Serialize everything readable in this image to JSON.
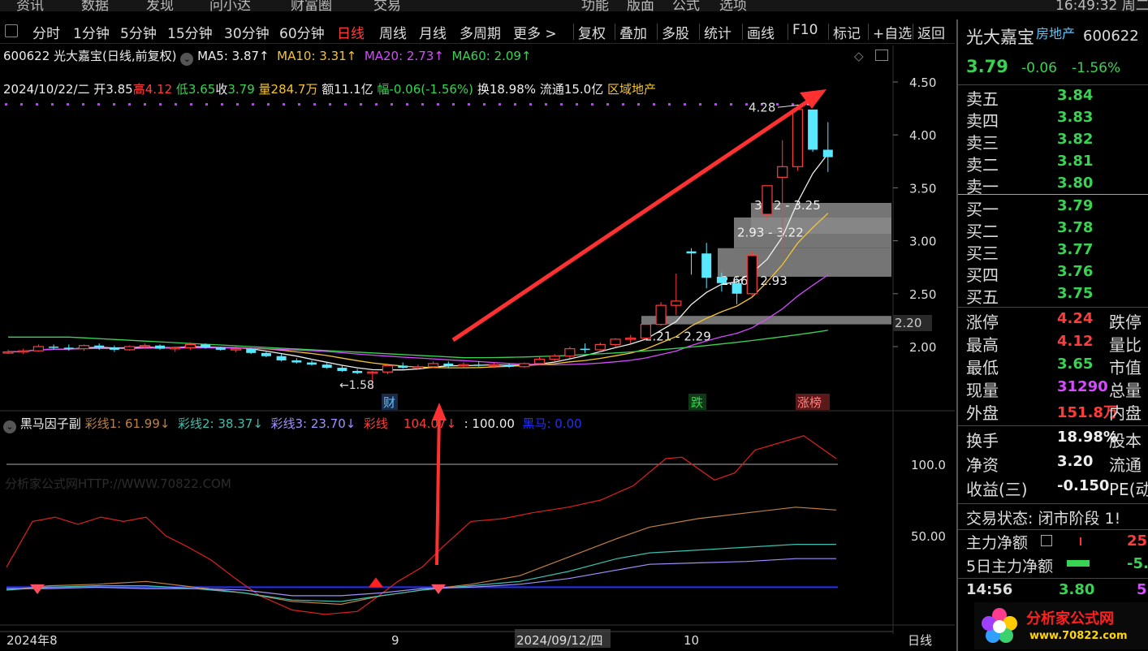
{
  "topbar": {
    "items": [
      "资讯",
      "数据",
      "发现",
      "问小达",
      "财富圈",
      "交易",
      "功能",
      "版面",
      "公式",
      "选项"
    ],
    "clock": "16:49:32 周二"
  },
  "toolbar": {
    "periods": [
      "分时",
      "1分钟",
      "5分钟",
      "15分钟",
      "30分钟",
      "60分钟",
      "日线",
      "周线",
      "月线",
      "多周期",
      "更多 >"
    ],
    "active": "日线",
    "tools": [
      "复权",
      "叠加",
      "多股",
      "统计",
      "画线",
      "F10",
      "标记",
      "+自选",
      "返回"
    ]
  },
  "header": {
    "title": "600622 光大嘉宝(日线,前复权)",
    "ma5": "MA5: 3.87↑",
    "ma10": "MA10: 3.31↑",
    "ma20": "MA20: 2.73↑",
    "ma60": "MA60: 2.09↑"
  },
  "quote_line": {
    "date": "2024/10/22/二",
    "open": "开3.85",
    "high_lbl": "高",
    "high": "4.12",
    "low_lbl": "低",
    "low": "3.65",
    "close_lbl": "收",
    "close": "3.79",
    "vol": "量284.7万",
    "amt": "额11.1亿",
    "chg": "幅-0.06(-1.56%)",
    "turnover": "换18.98%",
    "float": "流通15.0亿",
    "sector": "区域地产"
  },
  "chart_data": {
    "type": "candlestick",
    "y_ticks": [
      "4.50",
      "4.00",
      "3.50",
      "3.00",
      "2.50",
      "2.00"
    ],
    "y_range": [
      1.6,
      4.55
    ],
    "x_labels": [
      "2024年8",
      "9",
      "2024/09/12/四",
      "10",
      "日线"
    ],
    "price_marker": "2.20",
    "annotations": {
      "high": "4.28",
      "low": "1.58",
      "fin": "财",
      "drop": "跌",
      "limit": "涨榜"
    },
    "gaps": [
      {
        "label": "3.22 - 3.25",
        "from": 3.22,
        "to": 3.25
      },
      {
        "label": "2.93 - 3.22",
        "from": 2.93,
        "to": 3.22
      },
      {
        "label": "2.66 - 2.93",
        "from": 2.66,
        "to": 2.93
      },
      {
        "label": "2.21 - 2.29",
        "from": 2.21,
        "to": 2.29
      }
    ],
    "candles": [
      [
        1.95,
        1.97,
        1.93,
        1.95
      ],
      [
        1.95,
        1.98,
        1.93,
        1.96
      ],
      [
        1.96,
        2.02,
        1.95,
        2.0
      ],
      [
        2.0,
        2.02,
        1.97,
        1.99
      ],
      [
        1.99,
        2.02,
        1.96,
        1.98
      ],
      [
        1.98,
        2.02,
        1.96,
        2.01
      ],
      [
        2.01,
        2.03,
        1.97,
        1.99
      ],
      [
        1.99,
        2.01,
        1.95,
        1.97
      ],
      [
        1.97,
        2.01,
        1.96,
        2.0
      ],
      [
        2.0,
        2.03,
        1.98,
        2.01
      ],
      [
        2.01,
        2.02,
        1.97,
        1.98
      ],
      [
        1.98,
        2.0,
        1.95,
        1.99
      ],
      [
        1.99,
        2.04,
        1.97,
        2.02
      ],
      [
        2.02,
        2.03,
        1.98,
        1.99
      ],
      [
        1.99,
        2.0,
        1.96,
        1.97
      ],
      [
        1.97,
        2.0,
        1.95,
        1.98
      ],
      [
        1.98,
        1.99,
        1.93,
        1.94
      ],
      [
        1.94,
        1.95,
        1.9,
        1.91
      ],
      [
        1.91,
        1.93,
        1.86,
        1.87
      ],
      [
        1.87,
        1.89,
        1.84,
        1.85
      ],
      [
        1.85,
        1.87,
        1.82,
        1.83
      ],
      [
        1.83,
        1.85,
        1.79,
        1.8
      ],
      [
        1.8,
        1.82,
        1.76,
        1.77
      ],
      [
        1.77,
        1.79,
        1.74,
        1.75
      ],
      [
        1.75,
        1.77,
        1.6,
        1.76
      ],
      [
        1.76,
        1.84,
        1.74,
        1.82
      ],
      [
        1.82,
        1.85,
        1.79,
        1.8
      ],
      [
        1.8,
        1.83,
        1.78,
        1.81
      ],
      [
        1.81,
        1.86,
        1.8,
        1.84
      ],
      [
        1.84,
        1.86,
        1.8,
        1.82
      ],
      [
        1.82,
        1.85,
        1.8,
        1.83
      ],
      [
        1.83,
        1.86,
        1.81,
        1.82
      ],
      [
        1.82,
        1.85,
        1.8,
        1.83
      ],
      [
        1.83,
        1.84,
        1.8,
        1.81
      ],
      [
        1.81,
        1.85,
        1.8,
        1.84
      ],
      [
        1.84,
        1.9,
        1.83,
        1.88
      ],
      [
        1.88,
        1.93,
        1.86,
        1.91
      ],
      [
        1.91,
        2.0,
        1.89,
        1.98
      ],
      [
        1.98,
        2.03,
        1.94,
        1.97
      ],
      [
        1.97,
        2.04,
        1.95,
        2.02
      ],
      [
        2.02,
        2.08,
        2.0,
        2.07
      ],
      [
        2.07,
        2.11,
        2.03,
        2.08
      ],
      [
        2.08,
        2.22,
        2.06,
        2.21
      ],
      [
        2.21,
        2.42,
        2.2,
        2.39
      ],
      [
        2.39,
        2.69,
        2.3,
        2.43
      ],
      [
        2.9,
        2.93,
        2.68,
        2.88
      ],
      [
        2.88,
        2.98,
        2.55,
        2.65
      ],
      [
        2.66,
        2.7,
        2.52,
        2.6
      ],
      [
        2.6,
        2.66,
        2.4,
        2.5
      ],
      [
        2.5,
        2.9,
        2.48,
        2.86
      ],
      [
        3.25,
        3.52,
        3.2,
        3.52
      ],
      [
        3.6,
        3.95,
        2.85,
        3.7
      ],
      [
        3.7,
        4.28,
        3.66,
        4.24
      ],
      [
        4.24,
        4.24,
        3.84,
        3.86
      ],
      [
        3.86,
        4.12,
        3.65,
        3.79
      ]
    ]
  },
  "subchart": {
    "title": "黑马因子副",
    "l1": "彩线1: 61.99↓",
    "l2": "彩线2: 38.37↓",
    "l3": "彩线3: 23.70↓",
    "l4a": "彩线",
    "l4b": "104.07↓",
    "l5": ": 100.00",
    "l6": "黑马: 0.00",
    "y_ticks": [
      "100.0",
      "50.00"
    ],
    "watermark": "分析家公式网HTTP://WWW.70822.COM"
  },
  "side": {
    "name": "光大嘉宝",
    "sector": "房地产",
    "code": "600622",
    "price": "3.79",
    "change": "-0.06",
    "pct": "-1.56%",
    "asks": [
      {
        "l": "卖五",
        "v": "3.84"
      },
      {
        "l": "卖四",
        "v": "3.83"
      },
      {
        "l": "卖三",
        "v": "3.82"
      },
      {
        "l": "卖二",
        "v": "3.81"
      },
      {
        "l": "卖一",
        "v": "3.80"
      }
    ],
    "bids": [
      {
        "l": "买一",
        "v": "3.79"
      },
      {
        "l": "买二",
        "v": "3.78"
      },
      {
        "l": "买三",
        "v": "3.77"
      },
      {
        "l": "买四",
        "v": "3.76"
      },
      {
        "l": "买五",
        "v": "3.75"
      }
    ],
    "stats": [
      {
        "l": "涨停",
        "v": "4.24",
        "r": "跌停"
      },
      {
        "l": "最高",
        "v": "4.12",
        "r": "量比"
      },
      {
        "l": "最低",
        "v": "3.65",
        "r": "市值"
      },
      {
        "l": "现量",
        "v": "31290",
        "r": "总量"
      },
      {
        "l": "外盘",
        "v": "151.8万",
        "r": "内盘"
      }
    ],
    "stats2": [
      {
        "l": "换手",
        "v": "18.98%",
        "r": "股本"
      },
      {
        "l": "净资",
        "v": "3.20",
        "r": "流通"
      },
      {
        "l": "收益(三)",
        "v": "-0.150",
        "r": "PE(动"
      }
    ],
    "trade_status": "交易状态: 闭市阶段 1!",
    "main_net": "主力净额",
    "main_net_v": "25",
    "main5": "5日主力净额",
    "main5_v": "-5.",
    "tick_time": "14:56",
    "tick_price": "3.80",
    "tick_vol": "5",
    "logo_text": "分析家公式网",
    "logo_url": "www.70822.com"
  }
}
